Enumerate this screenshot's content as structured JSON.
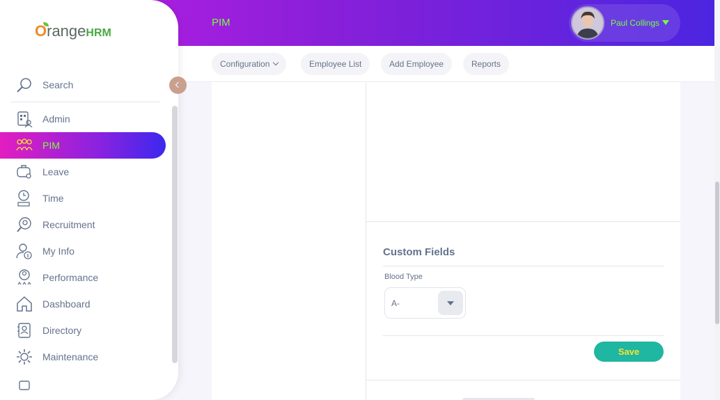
{
  "header": {
    "module_title": "PIM",
    "user_name": "Paul Collings",
    "colors": {
      "accent_text": "#76ff3c",
      "gradient_start": "#c51ee6",
      "gradient_end": "#4c25e0"
    }
  },
  "subnav": {
    "tabs": [
      {
        "label": "Configuration",
        "icon": "chevron-down-icon"
      },
      {
        "label": "Employee List"
      },
      {
        "label": "Add Employee"
      },
      {
        "label": "Reports"
      }
    ]
  },
  "brand": {
    "logo_text_o": "O",
    "logo_text_range": "range",
    "logo_text_hrm": "HRM"
  },
  "sidebar": {
    "search_label": "Search",
    "items": [
      {
        "label": "Admin",
        "icon": "admin-icon"
      },
      {
        "label": "PIM",
        "icon": "pim-icon",
        "active": true
      },
      {
        "label": "Leave",
        "icon": "leave-icon"
      },
      {
        "label": "Time",
        "icon": "time-icon"
      },
      {
        "label": "Recruitment",
        "icon": "recruitment-icon"
      },
      {
        "label": "My Info",
        "icon": "my-info-icon"
      },
      {
        "label": "Performance",
        "icon": "performance-icon"
      },
      {
        "label": "Dashboard",
        "icon": "dashboard-icon"
      },
      {
        "label": "Directory",
        "icon": "directory-icon"
      },
      {
        "label": "Maintenance",
        "icon": "maintenance-icon"
      }
    ]
  },
  "custom_fields": {
    "title": "Custom Fields",
    "blood_type_label": "Blood Type",
    "blood_type_value": "A-",
    "save_label": "Save",
    "save_color": "#1fb6a2"
  }
}
